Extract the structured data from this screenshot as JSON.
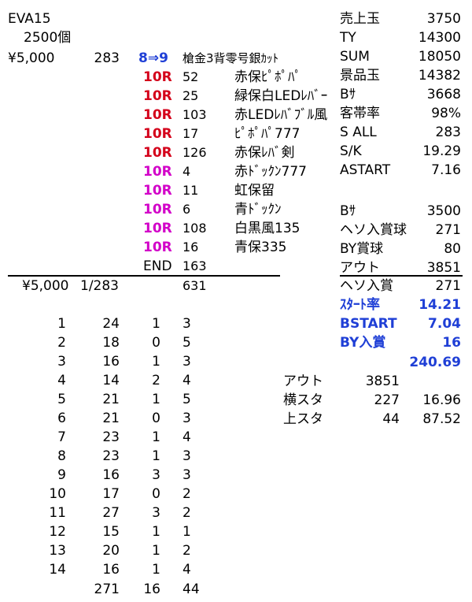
{
  "header": {
    "title": "EVA15",
    "balls": "2500個",
    "money": "¥5,000",
    "rot": "283",
    "arrow": "8⇒9",
    "desc": "槍金3背零号銀ｶｯﾄ"
  },
  "rounds": [
    {
      "r": "10R",
      "color": "red",
      "n": "52",
      "note": "赤保ﾋﾟﾎﾟﾊﾟ"
    },
    {
      "r": "10R",
      "color": "red",
      "n": "25",
      "note": "緑保白LEDﾚﾊﾞｰ"
    },
    {
      "r": "10R",
      "color": "red",
      "n": "103",
      "note": "赤LEDﾚﾊﾞﾌﾞﾙ風"
    },
    {
      "r": "10R",
      "color": "red",
      "n": "17",
      "note": "ﾋﾟﾎﾟﾊﾟ777"
    },
    {
      "r": "10R",
      "color": "red",
      "n": "126",
      "note": "赤保ﾚﾊﾞ剣"
    },
    {
      "r": "10R",
      "color": "mag",
      "n": "4",
      "note": "赤ﾄﾞｯｸﾝ777"
    },
    {
      "r": "10R",
      "color": "mag",
      "n": "11",
      "note": "虹保留"
    },
    {
      "r": "10R",
      "color": "mag",
      "n": "6",
      "note": "青ﾄﾞｯｸﾝ"
    },
    {
      "r": "10R",
      "color": "mag",
      "n": "108",
      "note": "白黒風135"
    },
    {
      "r": "10R",
      "color": "mag",
      "n": "16",
      "note": "青保335"
    }
  ],
  "end_row": {
    "label": "END",
    "value": "163"
  },
  "summary_row": {
    "money": "¥5,000",
    "ratio": "1/283",
    "total": "631"
  },
  "stats_right": [
    {
      "label": "売上玉",
      "value": "3750"
    },
    {
      "label": "TY",
      "value": "14300"
    },
    {
      "label": "SUM",
      "value": "18050"
    },
    {
      "label": "景品玉",
      "value": "14382"
    },
    {
      "label": "Bｻ",
      "value": "3668"
    },
    {
      "label": "客帯率",
      "value": "98%"
    },
    {
      "label": "S ALL",
      "value": "283"
    },
    {
      "label": "S/K",
      "value": "19.29"
    },
    {
      "label": "ASTART",
      "value": "7.16"
    }
  ],
  "stats_right2": [
    {
      "label": "Bｻ",
      "value": "3500"
    },
    {
      "label": "ヘソ入賞球",
      "value": "271"
    },
    {
      "label": "BY賞球",
      "value": "80"
    },
    {
      "label": "アウト",
      "value": "3851"
    },
    {
      "label": "ヘソ入賞",
      "value": "271"
    }
  ],
  "stats_blue": [
    {
      "label": "ｽﾀｰﾄ率",
      "value": "14.21"
    },
    {
      "label": "BSTART",
      "value": "7.04"
    },
    {
      "label": "BY入賞",
      "value": "16"
    }
  ],
  "blue_total": "240.69",
  "out_block": [
    {
      "label": "アウト",
      "v1": "3851",
      "v2": ""
    },
    {
      "label": "横スタ",
      "v1": "227",
      "v2": "16.96"
    },
    {
      "label": "上スタ",
      "v1": "44",
      "v2": "87.52"
    }
  ],
  "table_rows": [
    [
      "1",
      "24",
      "1",
      "3"
    ],
    [
      "2",
      "18",
      "0",
      "5"
    ],
    [
      "3",
      "16",
      "1",
      "3"
    ],
    [
      "4",
      "14",
      "2",
      "4"
    ],
    [
      "5",
      "21",
      "1",
      "5"
    ],
    [
      "6",
      "21",
      "0",
      "3"
    ],
    [
      "7",
      "23",
      "1",
      "4"
    ],
    [
      "8",
      "23",
      "1",
      "3"
    ],
    [
      "9",
      "16",
      "3",
      "3"
    ],
    [
      "10",
      "17",
      "0",
      "2"
    ],
    [
      "11",
      "27",
      "3",
      "2"
    ],
    [
      "12",
      "15",
      "1",
      "1"
    ],
    [
      "13",
      "20",
      "1",
      "2"
    ],
    [
      "14",
      "16",
      "1",
      "4"
    ]
  ],
  "totals_row": {
    "b": "271",
    "c": "16",
    "d": "44"
  },
  "colors": {
    "red": "#d4001a",
    "magenta": "#d200c8",
    "blue": "#1f3fd6"
  }
}
